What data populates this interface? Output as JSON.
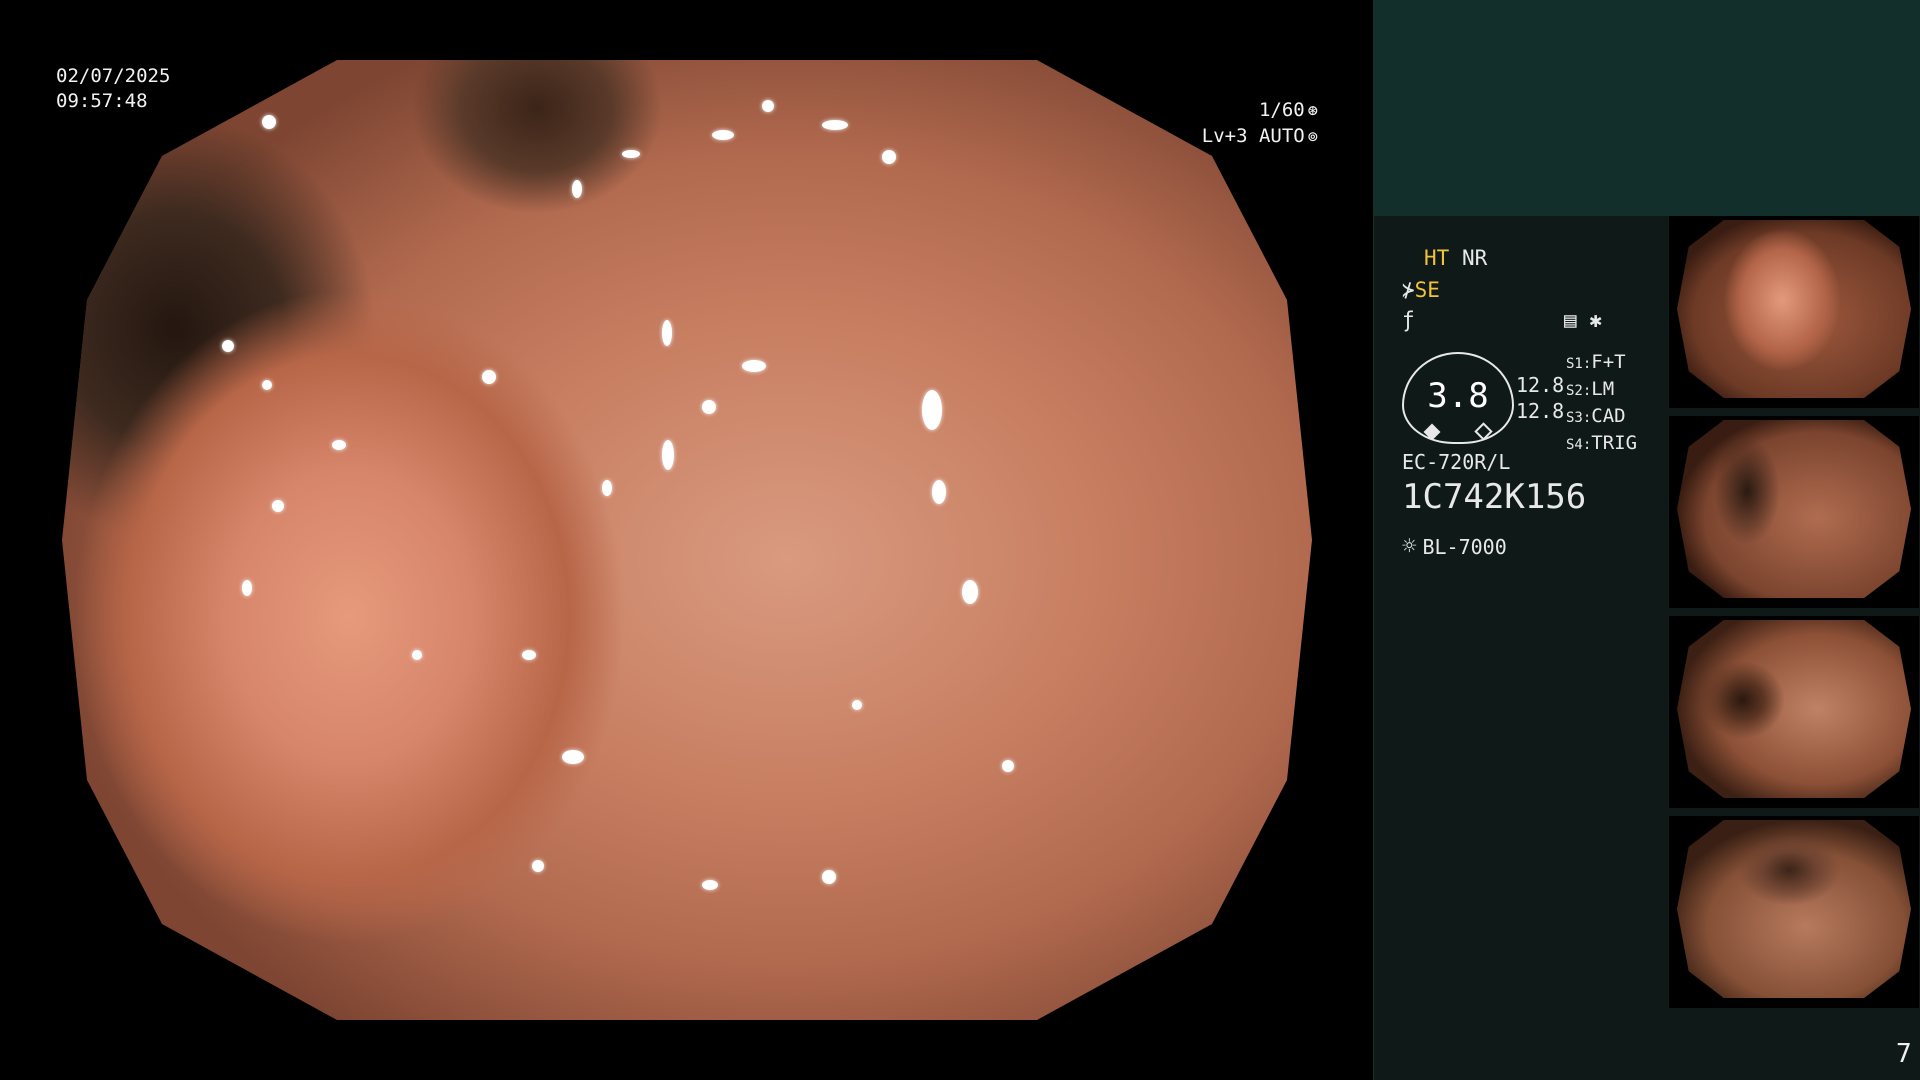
{
  "overlay": {
    "date": "02/07/2025",
    "time": "09:57:48",
    "shutter": "1/60",
    "level": "Lv+3 AUTO"
  },
  "panel": {
    "ht": "HT",
    "nr": "NR",
    "se": "SE",
    "dial_value": "3.8",
    "reading_1": "12.8",
    "reading_2": "12.8",
    "s_list": [
      {
        "tag": "S1:",
        "value": "F+T"
      },
      {
        "tag": "S2:",
        "value": "LM"
      },
      {
        "tag": "S3:",
        "value": "CAD"
      },
      {
        "tag": "S4:",
        "value": "TRIG"
      }
    ],
    "scope_model": "EC-720R/L",
    "serial": "1C742K156",
    "light_source": "BL-7000",
    "page_number": "7"
  },
  "colors": {
    "accent_yellow": "#f3c23a",
    "panel_bg": "#0f1a18",
    "panel_top_bg": "#132f2b"
  },
  "icons": {
    "shutter": "aperture-icon",
    "auto": "exposure-icon",
    "se": "se-curve-icon",
    "f": "edge-enhance-icon",
    "grid": "menu-grid-icon",
    "asterisk": "asterisk-icon",
    "light": "lamp-icon"
  }
}
